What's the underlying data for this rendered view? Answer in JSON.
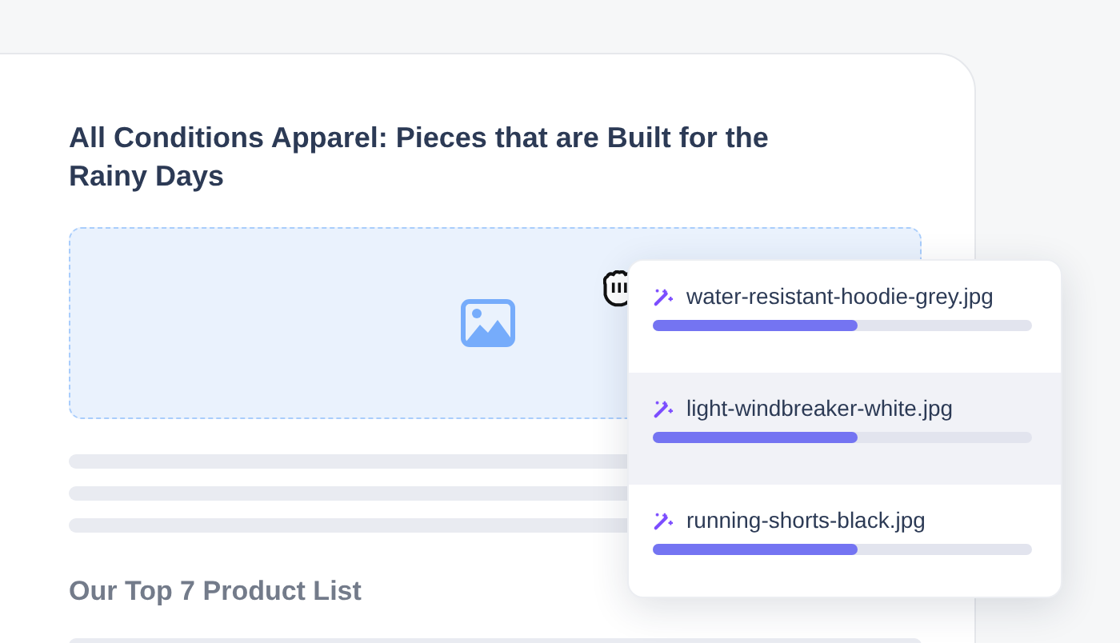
{
  "article": {
    "title": "All Conditions Apparel: Pieces that are Built for the Rainy Days",
    "subheading": "Our Top 7 Product List"
  },
  "uploads": [
    {
      "filename": "water-resistant-hoodie-grey.jpg",
      "level": 0.54,
      "selected": false
    },
    {
      "filename": "light-windbreaker-white.jpg",
      "level": 0.54,
      "selected": true
    },
    {
      "filename": "running-shorts-black.jpg",
      "level": 0.54,
      "selected": false
    }
  ]
}
